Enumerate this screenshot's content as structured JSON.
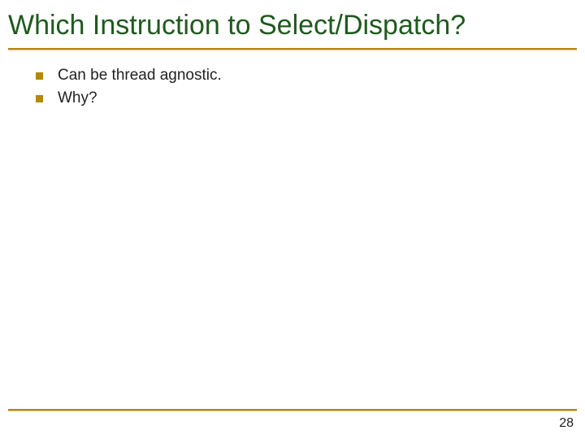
{
  "title": "Which Instruction to Select/Dispatch?",
  "bullets": [
    "Can be thread agnostic.",
    "Why?"
  ],
  "page_number": "28"
}
